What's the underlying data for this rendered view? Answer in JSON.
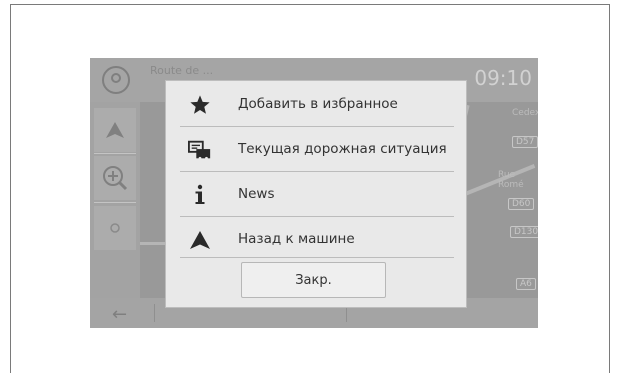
{
  "status_bar": {
    "route_label": "Route de ...",
    "time": "09:10"
  },
  "map": {
    "labels": [
      "Cedex",
      "Rue Romé"
    ],
    "road_shields": [
      "D57",
      "D60",
      "D130",
      "A6"
    ]
  },
  "menu": {
    "items": [
      {
        "label": "Добавить в избранное",
        "icon": "star-icon"
      },
      {
        "label": "Текущая дорожная ситуация",
        "icon": "traffic-icon"
      },
      {
        "label": "News",
        "icon": "info-icon"
      },
      {
        "label": "Назад к машине",
        "icon": "vehicle-arrow-icon"
      }
    ],
    "close_label": "Закр."
  }
}
